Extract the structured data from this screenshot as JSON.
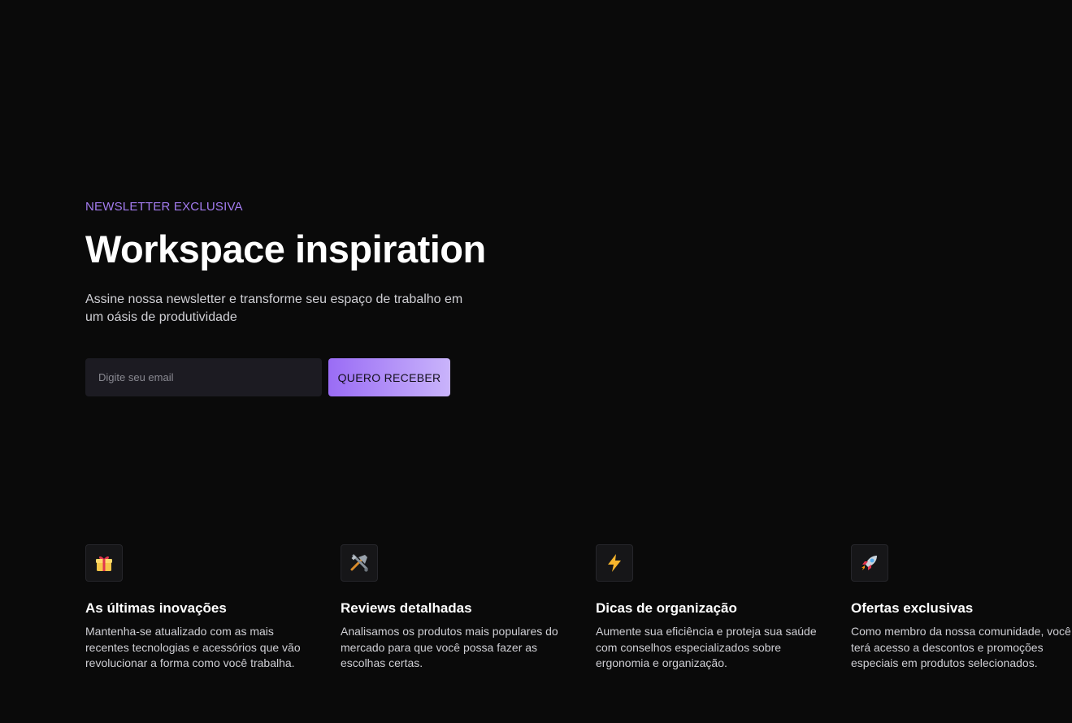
{
  "hero": {
    "eyebrow": "NEWSLETTER EXCLUSIVA",
    "title": "Workspace inspiration",
    "subtitle": "Assine nossa newsletter e transforme seu espaço de trabalho em um oásis de produtividade"
  },
  "form": {
    "email_placeholder": "Digite seu email",
    "email_value": "",
    "submit_label": "QUERO RECEBER"
  },
  "colors": {
    "background": "#0a0a0a",
    "accent": "#a47cf0",
    "button_gradient_start": "#9a6cf5",
    "button_gradient_end": "#c9b4fb"
  },
  "features": [
    {
      "icon": "gift-icon",
      "title": "As últimas inovações",
      "description": "Mantenha-se atualizado com as mais recentes tecnologias e acessórios que vão revolucionar a forma como você trabalha."
    },
    {
      "icon": "tools-icon",
      "title": "Reviews detalhadas",
      "description": "Analisamos os produtos mais populares do mercado para que você possa fazer as escolhas certas."
    },
    {
      "icon": "lightning-icon",
      "title": "Dicas de organização",
      "description": "Aumente sua eficiência e proteja sua saúde com conselhos especializados sobre ergonomia e organização."
    },
    {
      "icon": "rocket-icon",
      "title": "Ofertas exclusivas",
      "description": "Como membro da nossa comunidade, você terá acesso a descontos e promoções especiais em produtos selecionados."
    }
  ]
}
